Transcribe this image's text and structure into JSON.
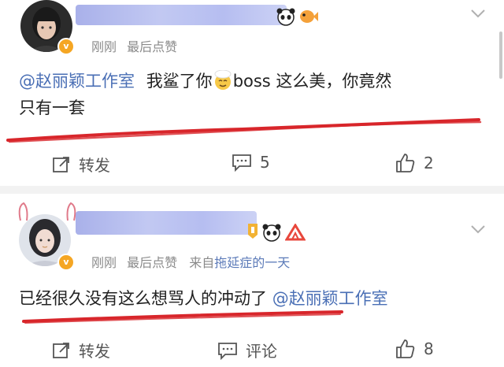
{
  "posts": [
    {
      "meta": {
        "time": "刚刚",
        "likes_label": "最后点赞"
      },
      "content": {
        "mention": "@赵丽颖工作室",
        "text_before_emoji": "我鲨了你",
        "text_after_emoji": "boss 这么美，你竟然",
        "line2": "只有一套"
      },
      "actions": {
        "repost": "转发",
        "comments": "5",
        "likes": "2"
      }
    },
    {
      "meta": {
        "time": "刚刚",
        "likes_label": "最后点赞",
        "source_prefix": "来自",
        "source_name": "拖延症的一天"
      },
      "content": {
        "text": "已经很久没有这么想骂人的冲动了",
        "mention": "@赵丽颖工作室"
      },
      "actions": {
        "repost": "转发",
        "comments": "评论",
        "likes": "8"
      }
    }
  ],
  "colors": {
    "link": "#4a6fb5",
    "meta": "#8a8a8a",
    "annotation_red": "#d8262b",
    "badge": "#f5a623",
    "scribble": "#a9b2ee"
  },
  "icons": [
    "repost-icon",
    "comment-icon",
    "like-icon",
    "chevron-down-icon",
    "verified-badge-icon"
  ]
}
